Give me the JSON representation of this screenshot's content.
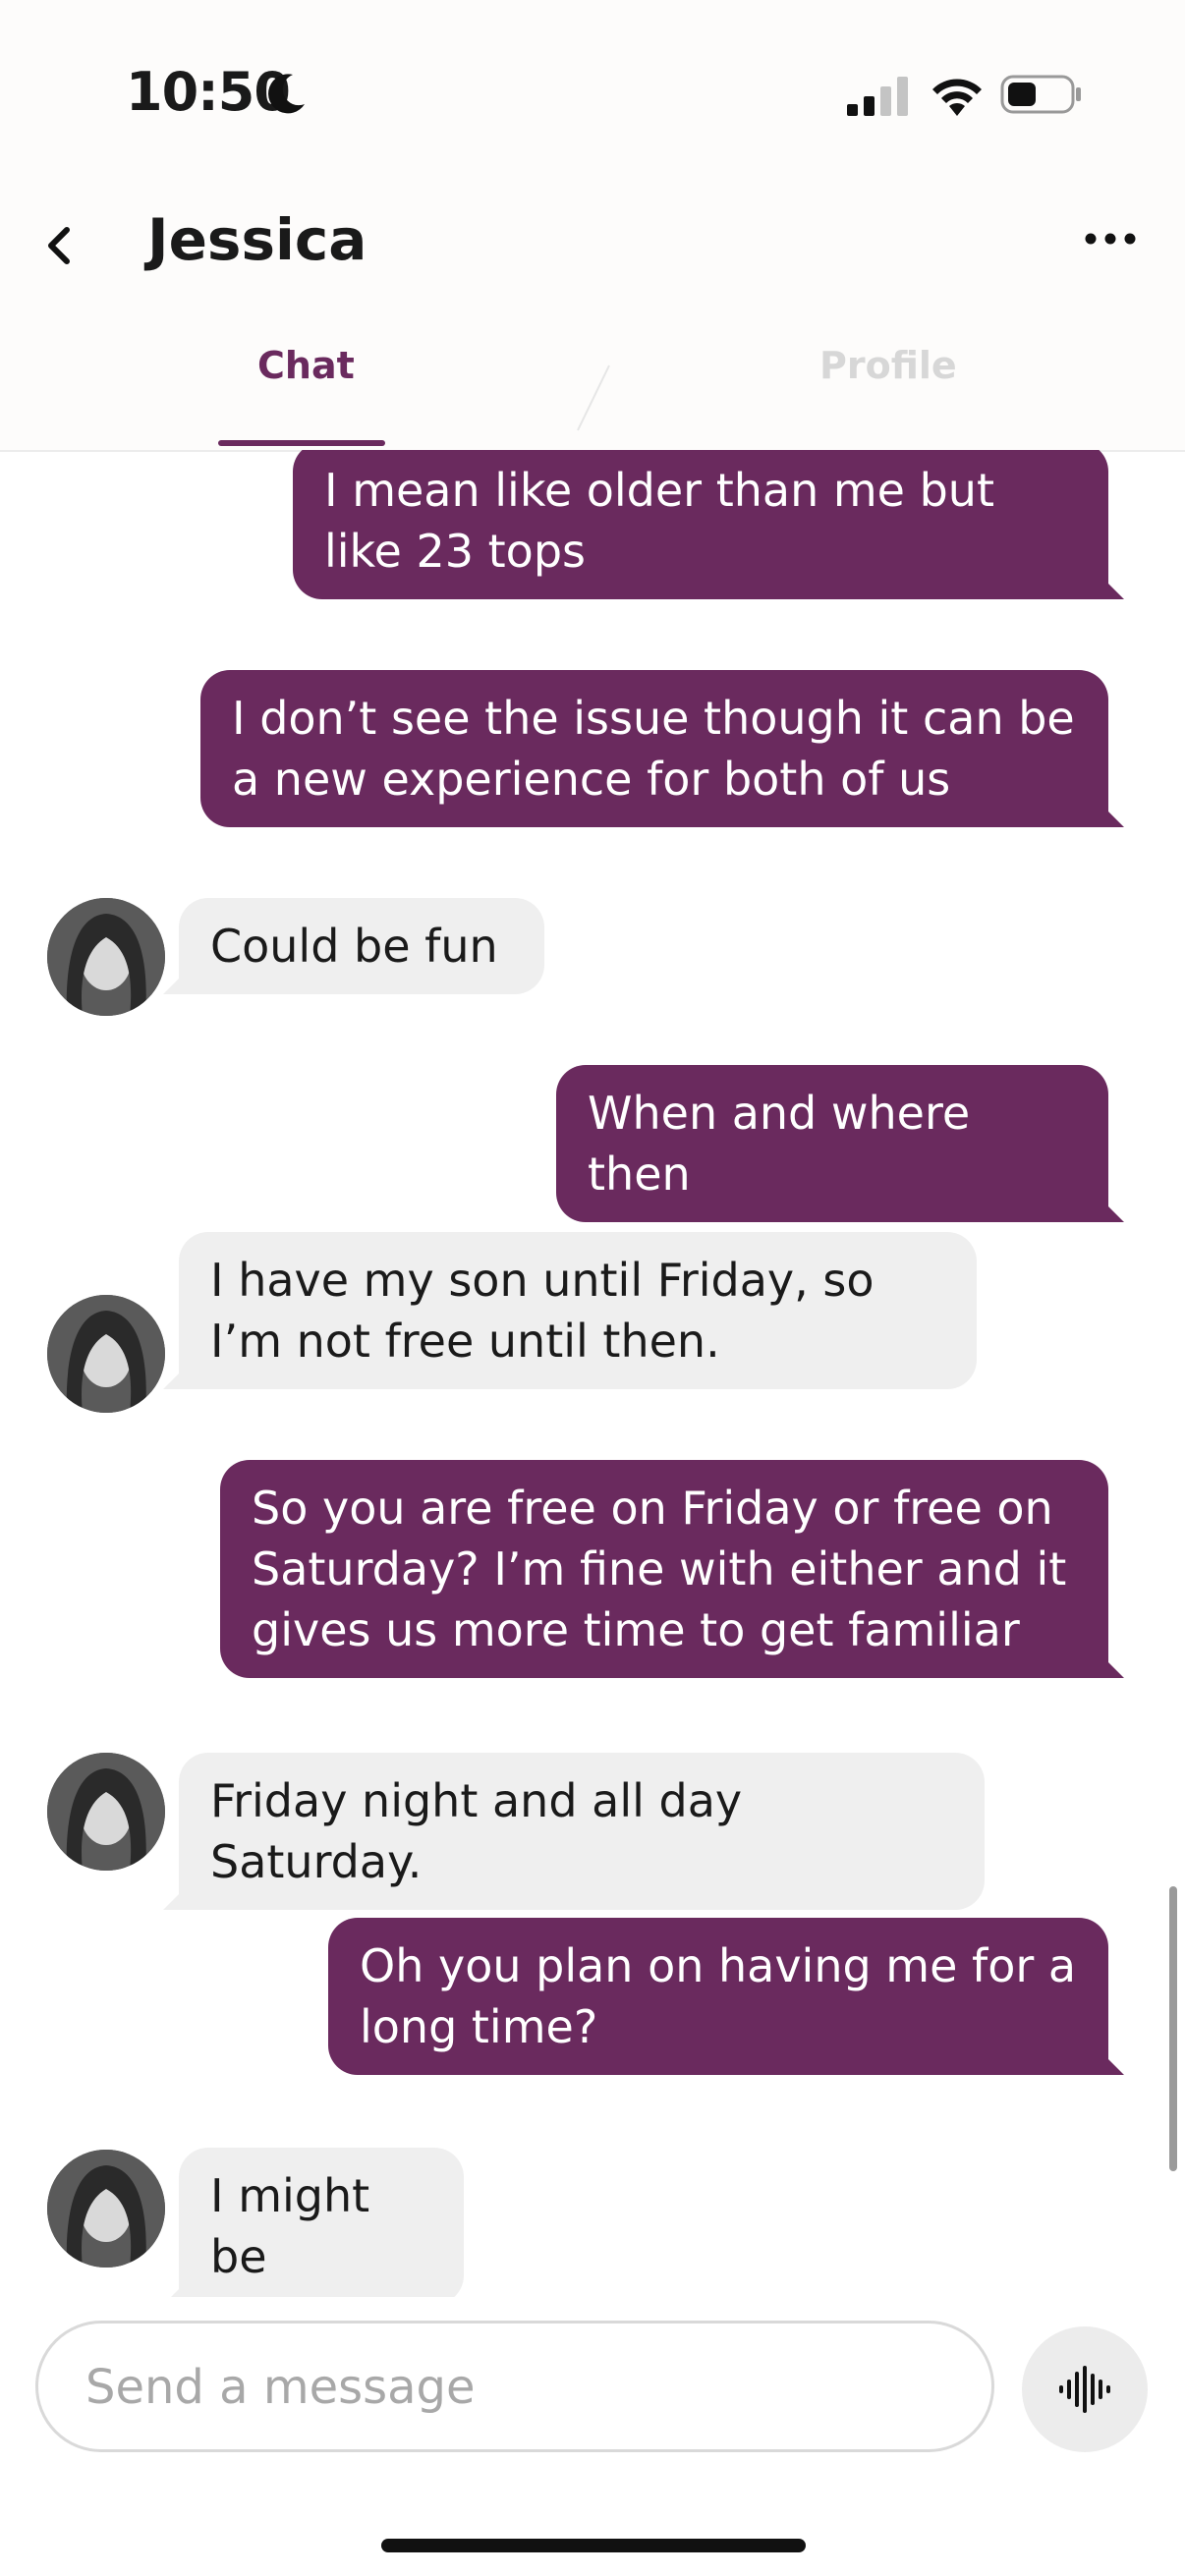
{
  "status_bar": {
    "time": "10:50"
  },
  "header": {
    "contact_name": "Jessica",
    "tabs": [
      {
        "label": "Chat",
        "active": true
      },
      {
        "label": "Profile",
        "active": false
      }
    ]
  },
  "messages": [
    {
      "from": "me",
      "text": "I mean like older than me but like 23 tops"
    },
    {
      "from": "me",
      "text": "I don’t see the issue though it can be a new experience for both of us"
    },
    {
      "from": "them",
      "text": "Could be fun"
    },
    {
      "from": "me",
      "text": "When and where then"
    },
    {
      "from": "them",
      "text": "I have my son until Friday, so I’m not free until then."
    },
    {
      "from": "me",
      "text": "So you are free on Friday or free on Saturday? I’m fine with either and it gives us more time to get familiar"
    },
    {
      "from": "them",
      "text": "Friday night and all day Saturday."
    },
    {
      "from": "me",
      "text": "Oh you plan on having me for a long time?"
    },
    {
      "from": "them",
      "text": "I might be"
    }
  ],
  "composer": {
    "placeholder": "Send a message",
    "value": ""
  },
  "colors": {
    "accent": "#6a2a5e",
    "incoming_bubble": "#efefef",
    "inactive_tab": "#d7d7d7"
  },
  "icons": [
    "back-chevron-icon",
    "more-options-icon",
    "voice-message-icon",
    "moon-icon",
    "signal-icon",
    "wifi-icon",
    "battery-icon"
  ]
}
